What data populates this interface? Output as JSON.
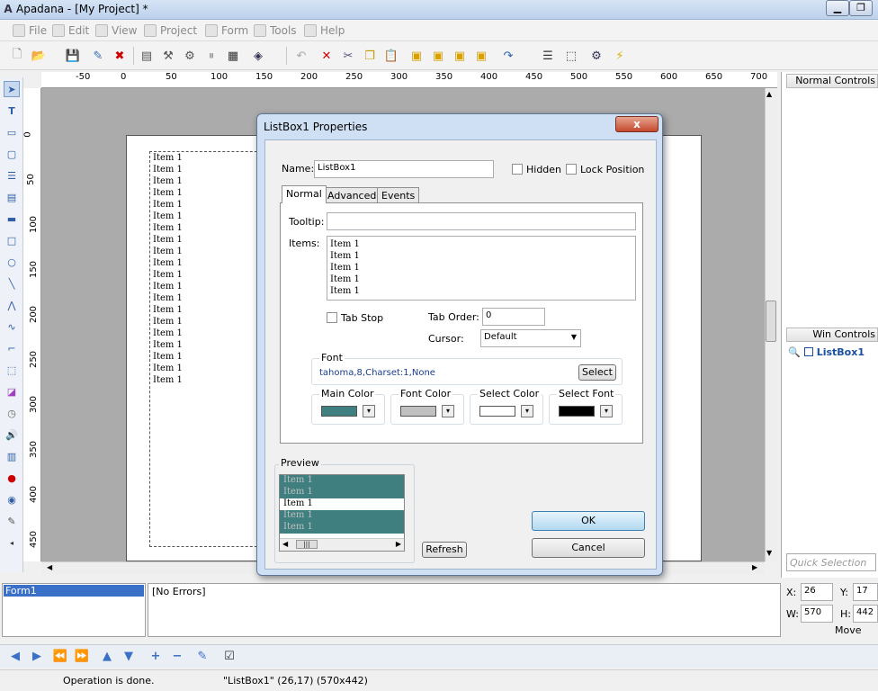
{
  "window": {
    "title": "Apadana - [My Project] *",
    "app_icon": "A"
  },
  "menu": [
    {
      "label": "File",
      "icon": "file-icon"
    },
    {
      "label": "Edit",
      "icon": "edit-icon"
    },
    {
      "label": "View",
      "icon": "view-icon"
    },
    {
      "label": "Project",
      "icon": "project-icon"
    },
    {
      "label": "Form",
      "icon": "form-icon"
    },
    {
      "label": "Tools",
      "icon": "tools-icon"
    },
    {
      "label": "Help",
      "icon": "help-icon"
    }
  ],
  "ruler": {
    "h_labels": [
      "-50",
      "0",
      "50",
      "100",
      "150",
      "200",
      "250",
      "300",
      "350",
      "400",
      "450",
      "500",
      "550",
      "600",
      "650",
      "700"
    ],
    "v_labels": [
      "0",
      "50",
      "100",
      "150",
      "200",
      "250",
      "300",
      "350",
      "400",
      "450"
    ]
  },
  "listbox_items": [
    "Item 1",
    "Item 1",
    "Item 1",
    "Item 1",
    "Item 1",
    "Item 1",
    "Item 1",
    "Item 1",
    "Item 1",
    "Item 1",
    "Item 1",
    "Item 1",
    "Item 1",
    "Item 1",
    "Item 1",
    "Item 1",
    "Item 1",
    "Item 1",
    "Item 1",
    "Item 1"
  ],
  "right_panel": {
    "normal_controls": "Normal Controls",
    "win_controls": "Win Controls",
    "win_item": "ListBox1",
    "quick_selection": "Quick Selection"
  },
  "bottom": {
    "form_name": "Form1",
    "errors": "[No Errors]",
    "x_label": "X:",
    "x_value": "26",
    "y_label": "Y:",
    "y_value": "17",
    "w_label": "W:",
    "w_value": "570",
    "h_label": "H:",
    "h_value": "442",
    "mode": "Move"
  },
  "status": {
    "left": "Operation is done.",
    "right": "\"ListBox1\" (26,17) (570x442)"
  },
  "dialog": {
    "title": "ListBox1 Properties",
    "close": "x",
    "name_label": "Name:",
    "name_value": "ListBox1",
    "hidden_label": "Hidden",
    "lock_label": "Lock Position",
    "tabs": [
      "Normal",
      "Advanced",
      "Events"
    ],
    "tooltip_label": "Tooltip:",
    "tooltip_value": "",
    "items_label": "Items:",
    "items": [
      "Item 1",
      "Item 1",
      "Item 1",
      "Item 1",
      "Item 1"
    ],
    "tabstop_label": "Tab Stop",
    "taborder_label": "Tab Order:",
    "taborder_value": "0",
    "cursor_label": "Cursor:",
    "cursor_value": "Default",
    "font_group": "Font",
    "font_value": "tahoma,8,Charset:1,None",
    "select_btn": "Select",
    "main_color": "Main Color",
    "font_color": "Font Color",
    "select_color": "Select Color",
    "select_font": "Select Font",
    "main_color_hex": "#3f7f7f",
    "font_color_hex": "#c0c0c0",
    "select_color_hex": "#ffffff",
    "select_font_hex": "#000000",
    "preview_label": "Preview",
    "preview_items": [
      "Item 1",
      "Item 1",
      "Item 1",
      "Item 1",
      "Item 1"
    ],
    "refresh_btn": "Refresh",
    "ok_btn": "OK",
    "cancel_btn": "Cancel"
  }
}
